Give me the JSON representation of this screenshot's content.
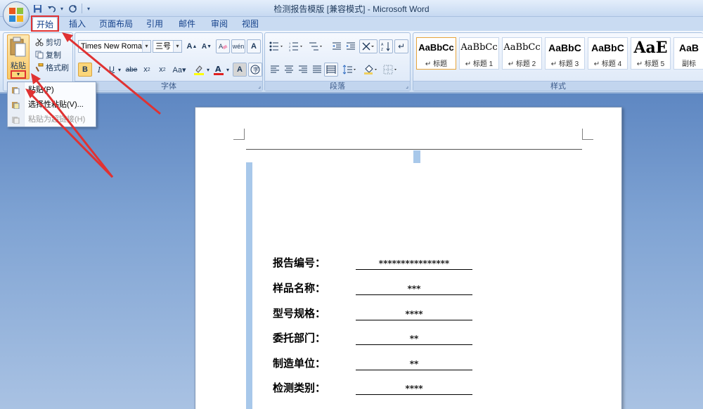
{
  "window": {
    "title": "检测报告模版 [兼容模式] - Microsoft Word"
  },
  "qat": {
    "icons": [
      "save-icon",
      "undo-icon",
      "redo-icon",
      "customize-icon"
    ]
  },
  "tabs": [
    {
      "label": "开始",
      "active": true
    },
    {
      "label": "插入"
    },
    {
      "label": "页面布局"
    },
    {
      "label": "引用"
    },
    {
      "label": "邮件"
    },
    {
      "label": "审阅"
    },
    {
      "label": "视图"
    }
  ],
  "clipboard": {
    "paste_label": "粘贴",
    "cut_label": "剪切",
    "copy_label": "复制",
    "format_painter_label": "格式刷"
  },
  "font": {
    "group_label": "字体",
    "font_name": "Times New Roman",
    "font_size": "三号"
  },
  "paragraph": {
    "group_label": "段落"
  },
  "styles": {
    "group_label": "样式",
    "items": [
      {
        "sample": "AaBbCc",
        "name": "↵ 标题"
      },
      {
        "sample": "AaBbCc",
        "name": "↵ 标题 1"
      },
      {
        "sample": "AaBbCc",
        "name": "↵ 标题 2"
      },
      {
        "sample": "AaBbC",
        "name": "↵ 标题 3"
      },
      {
        "sample": "AaBbC",
        "name": "↵ 标题 4"
      },
      {
        "sample": "AaE",
        "name": "↵ 标题 5"
      },
      {
        "sample": "AaB",
        "name": "副标"
      }
    ]
  },
  "paste_menu": {
    "items": [
      {
        "label": "粘贴(P)",
        "enabled": true
      },
      {
        "label": "选择性粘贴(V)...",
        "enabled": true
      },
      {
        "label": "粘贴为超链接(H)",
        "enabled": false
      }
    ]
  },
  "document": {
    "rows": [
      {
        "label": "报告编号：",
        "value": "****************"
      },
      {
        "label": "样品名称：",
        "value": "***"
      },
      {
        "label": "型号规格：",
        "value": "****"
      },
      {
        "label": "委托部门：",
        "value": "**"
      },
      {
        "label": "制造单位：",
        "value": "**"
      },
      {
        "label": "检测类别：",
        "value": "****"
      }
    ]
  },
  "colors": {
    "annotation": "#e03232",
    "ribbon_text": "#15428b"
  }
}
